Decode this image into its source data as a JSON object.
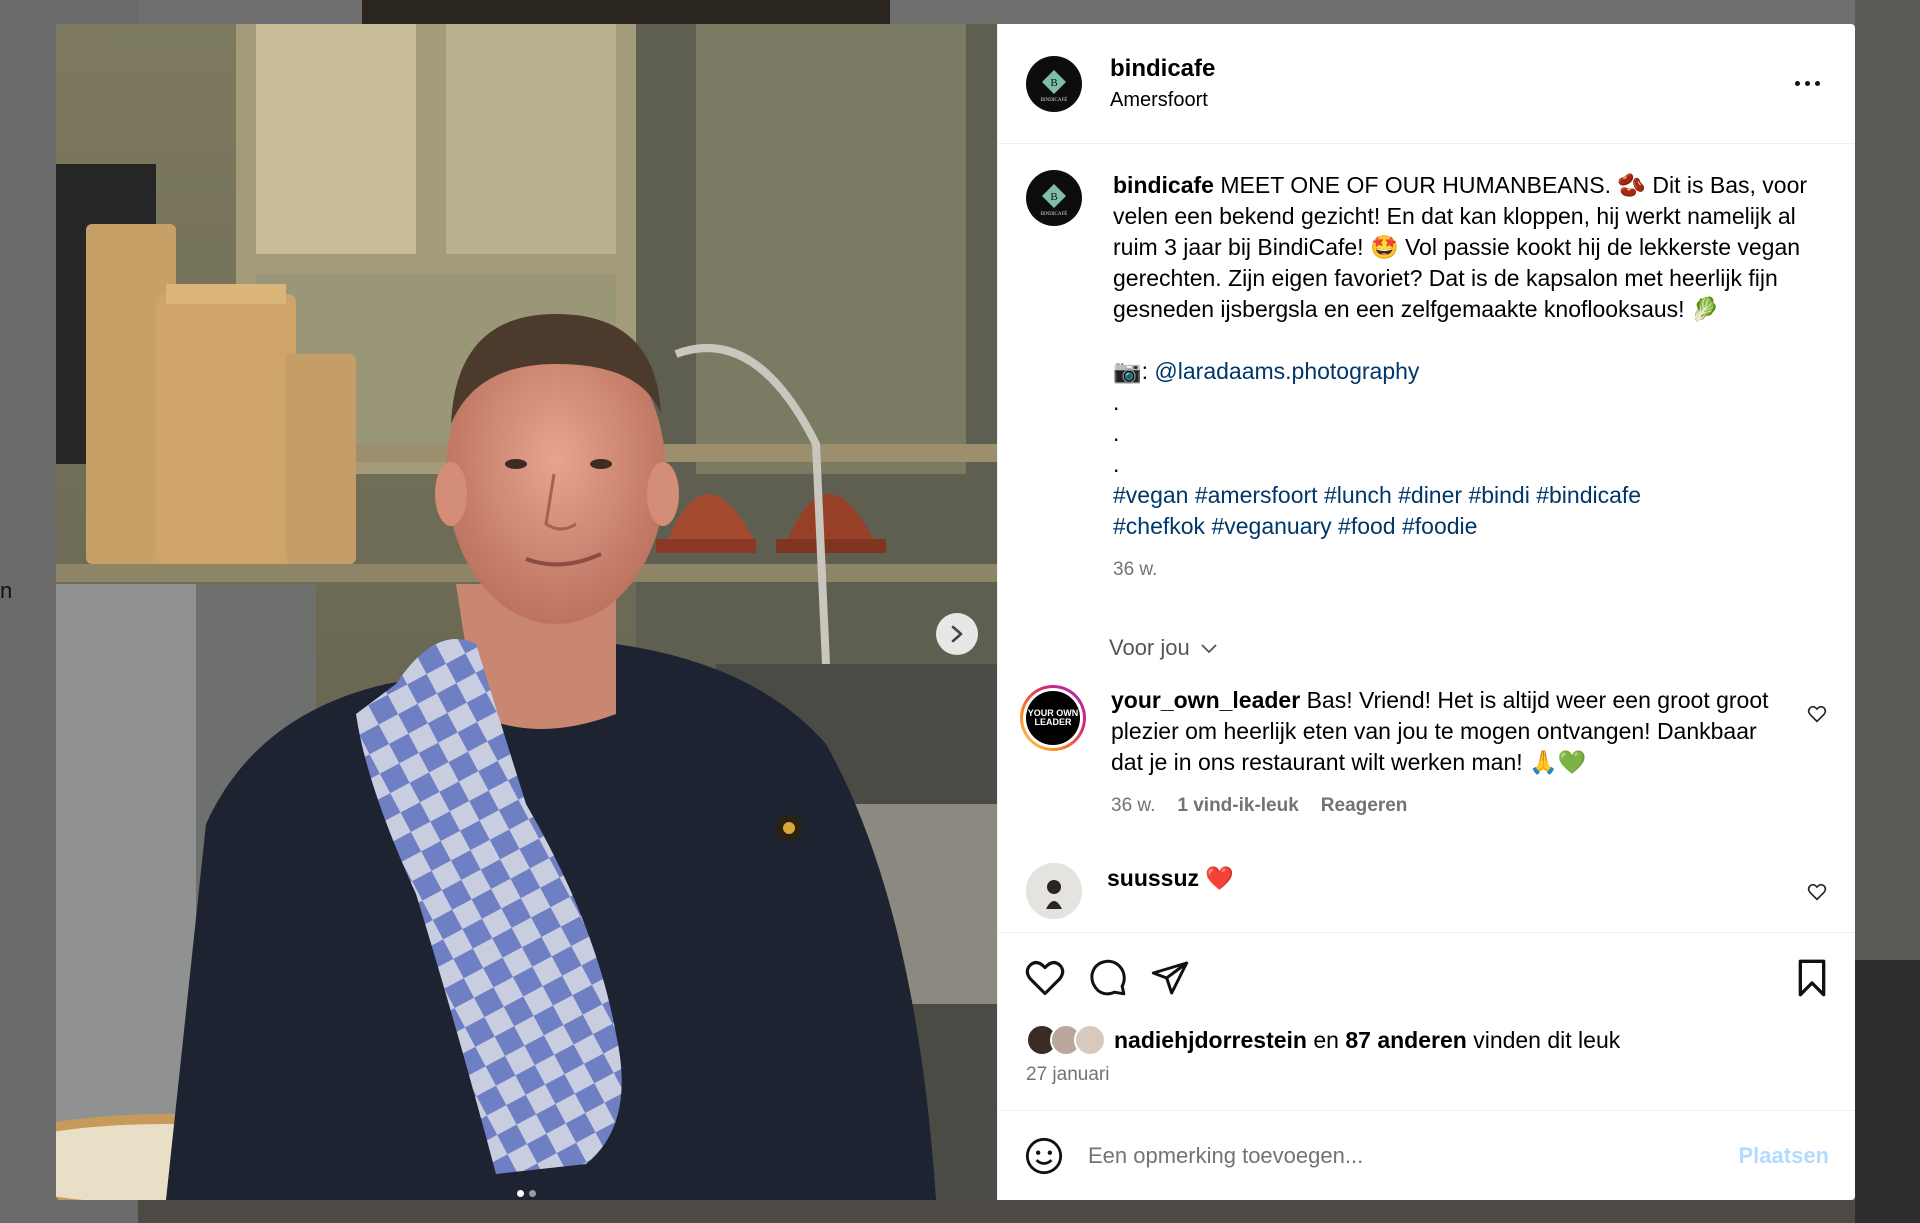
{
  "header": {
    "username": "bindicafe",
    "location": "Amersfoort"
  },
  "logo_text": {
    "letter": "B",
    "name": "BINDICAFÉ"
  },
  "background": {
    "stray_char": "n"
  },
  "caption": {
    "username": "bindicafe",
    "lines": [
      "MEET ONE OF OUR HUMANBEANS. 🫘 Dit is Bas, voor velen een bekend gezicht! En dat kan kloppen, hij werkt namelijk al ruim 3 jaar bij BindiCafe! 🤩 Vol passie kookt hij de lekkerste vegan gerechten. Zijn eigen favoriet? Dat is de kapsalon met heerlijk fijn gesneden ijsbergsla en een zelfgemaakte knoflooksaus! 🥬"
    ],
    "photo_credit_prefix": "📷: ",
    "photo_credit_link": "@laradaams.photography",
    "dots": [
      ".",
      ".",
      "."
    ],
    "hashtags_line1": "#vegan #amersfoort #lunch #diner #bindi #bindicafe",
    "hashtags_line2": "#chefkok #veganuary #food #foodie",
    "age": "36 w."
  },
  "for_you": "Voor jou",
  "comments": [
    {
      "username": "your_own_leader",
      "avatar_text": "YOUR OWN LEADER",
      "text": "Bas! Vriend! Het is altijd weer een groot groot plezier om heerlijk eten van jou te mogen ontvangen! Dankbaar dat je in ons restaurant wilt werken man! 🙏💚",
      "age": "36 w.",
      "likes": "1 vind-ik-leuk",
      "reply": "Reageren"
    },
    {
      "username": "suussuz",
      "text": "❤️"
    }
  ],
  "likes": {
    "first_user": "nadiehjdorrestein",
    "connector": " en ",
    "others": "87 anderen",
    "suffix": " vinden dit leuk"
  },
  "date": "27 januari",
  "add_comment": {
    "placeholder": "Een opmerking toevoegen...",
    "post_label": "Plaatsen"
  },
  "colors": {
    "link": "#00376b",
    "muted": "#737373",
    "post_disabled": "#b3dbff",
    "towel_blue": "#6f7fc4"
  }
}
